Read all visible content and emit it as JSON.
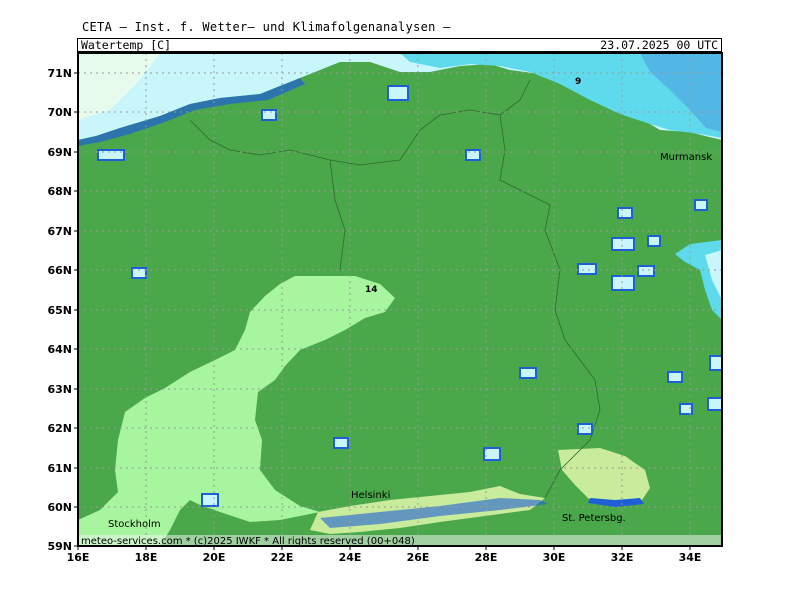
{
  "header": {
    "title": "CETA — Inst. f. Wetter— und Klimafolgenanalysen —",
    "parameter": "Watertemp [C]",
    "valid_time": "23.07.2025 00 UTC"
  },
  "map": {
    "lat_labels": [
      "71N",
      "70N",
      "69N",
      "68N",
      "67N",
      "66N",
      "65N",
      "64N",
      "63N",
      "62N",
      "61N",
      "60N",
      "59N"
    ],
    "lon_labels": [
      "16E",
      "18E",
      "20E",
      "22E",
      "24E",
      "26E",
      "28E",
      "30E",
      "32E",
      "34E"
    ],
    "cities": [
      {
        "name": "Murmansk"
      },
      {
        "name": "Helsinki"
      },
      {
        "name": "Stockholm"
      },
      {
        "name": "St. Petersbg."
      }
    ],
    "contour_values": [
      "9",
      "14"
    ],
    "footer": "meteo-services.com * (c)2025 IWKF * All rights reserved (00+048)"
  },
  "colors": {
    "land": "#4aa74a",
    "land_shadow": "#3d8f3d",
    "coast_blue": "#1f5fd6",
    "water_warm": "#a8f5a0",
    "water_mild": "#c9ec9c",
    "water_cool": "#c8f6fb",
    "water_cold": "#5fd9ec",
    "water_colder": "#53b7e6",
    "grid": "#aaaaaa"
  }
}
